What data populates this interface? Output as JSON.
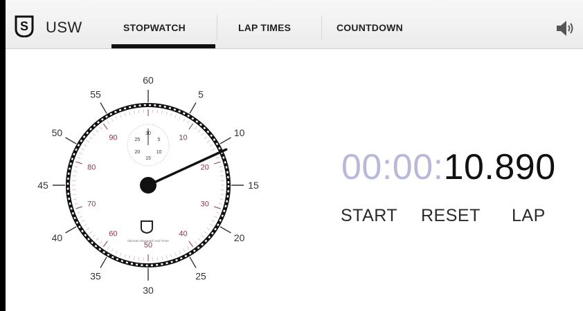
{
  "app": {
    "title": "USW",
    "logo_text": "S"
  },
  "tabs": [
    {
      "label": "STOPWATCH",
      "active": true
    },
    {
      "label": "LAP TIMES",
      "active": false
    },
    {
      "label": "COUNTDOWN",
      "active": false
    }
  ],
  "icons": {
    "logo": "usw-logo-icon",
    "speaker": "speaker-icon"
  },
  "dial": {
    "outer_labels": [
      "60",
      "5",
      "10",
      "15",
      "20",
      "25",
      "30",
      "35",
      "40",
      "45",
      "50",
      "55"
    ],
    "inner_labels": [
      "10",
      "20",
      "30",
      "40",
      "50",
      "60",
      "70",
      "80",
      "90"
    ],
    "subdial_labels": [
      "30",
      "5",
      "10",
      "15",
      "20",
      "25"
    ],
    "footer_text": "Ultimate Stopwatch and Timer",
    "elapsed_seconds": 10.89,
    "colors": {
      "outer_text": "#333333",
      "inner_text": "#8a3550",
      "hand": "#111111"
    }
  },
  "display": {
    "hours": "00",
    "minutes": "00",
    "sep1": ":",
    "sep2": ":",
    "seconds": "10.890",
    "dim_color": "#b8b8d8",
    "main_color": "#111111"
  },
  "controls": {
    "start": "START",
    "reset": "RESET",
    "lap": "LAP"
  }
}
